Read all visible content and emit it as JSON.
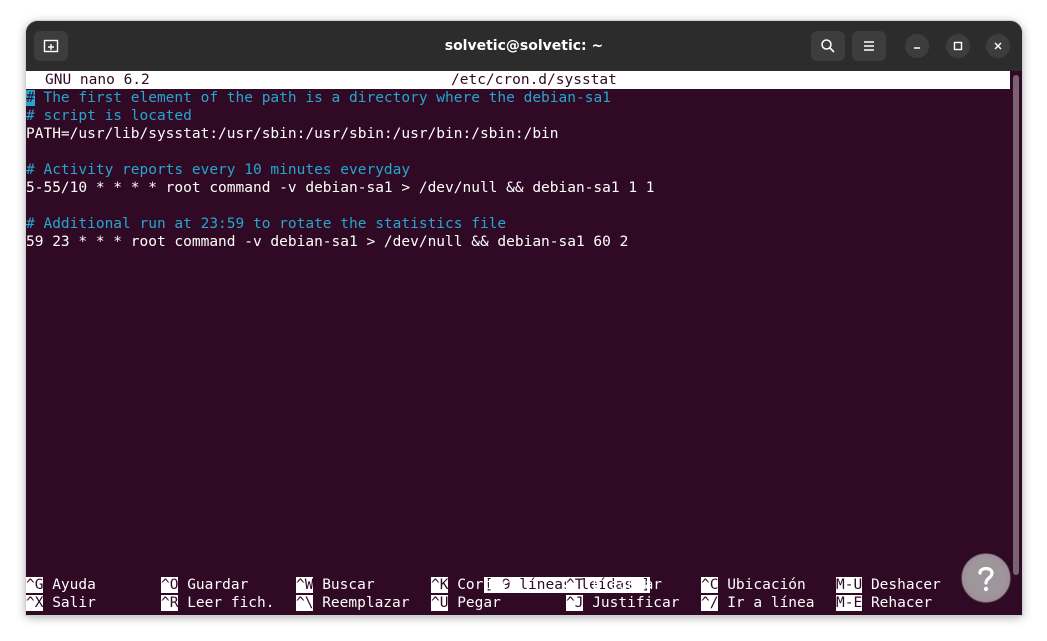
{
  "window": {
    "title": "solvetic@solvetic: ~",
    "icons": [
      "new-tab-icon",
      "search-icon",
      "menu-icon",
      "minimize-icon",
      "maximize-icon",
      "close-icon"
    ]
  },
  "nano": {
    "version": "GNU nano 6.2",
    "filename": "/etc/cron.d/sysstat",
    "lines": [
      {
        "text": "# The first element of the path is a directory where the debian-sa1",
        "type": "comment"
      },
      {
        "text": "# script is located",
        "type": "comment"
      },
      {
        "text": "PATH=/usr/lib/sysstat:/usr/sbin:/usr/sbin:/usr/bin:/sbin:/bin",
        "type": "code"
      },
      {
        "text": "",
        "type": "blank"
      },
      {
        "text": "# Activity reports every 10 minutes everyday",
        "type": "comment"
      },
      {
        "text": "5-55/10 * * * * root command -v debian-sa1 > /dev/null && debian-sa1 1 1",
        "type": "code"
      },
      {
        "text": "",
        "type": "blank"
      },
      {
        "text": "# Additional run at 23:59 to rotate the statistics file",
        "type": "comment"
      },
      {
        "text": "59 23 * * * root command -v debian-sa1 > /dev/null && debian-sa1 60 2",
        "type": "code"
      }
    ],
    "status_message": "[ 9 líneas leídas ]",
    "shortcuts_row1": [
      {
        "key": "^G",
        "label": "Ayuda"
      },
      {
        "key": "^O",
        "label": "Guardar"
      },
      {
        "key": "^W",
        "label": "Buscar"
      },
      {
        "key": "^K",
        "label": "Cortar"
      },
      {
        "key": "^T",
        "label": "Ejecutar"
      },
      {
        "key": "^C",
        "label": "Ubicación"
      },
      {
        "key": "M-U",
        "label": "Deshacer"
      }
    ],
    "shortcuts_row2": [
      {
        "key": "^X",
        "label": "Salir"
      },
      {
        "key": "^R",
        "label": "Leer fich."
      },
      {
        "key": "^\\",
        "label": "Reemplazar"
      },
      {
        "key": "^U",
        "label": "Pegar"
      },
      {
        "key": "^J",
        "label": "Justificar"
      },
      {
        "key": "^/",
        "label": "Ir a línea"
      },
      {
        "key": "M-E",
        "label": "Rehacer"
      }
    ]
  },
  "colors": {
    "terminal_bg": "#300a24",
    "titlebar_bg": "#2c2c2c",
    "comment": "#26a6cf",
    "text": "#ffffff"
  }
}
